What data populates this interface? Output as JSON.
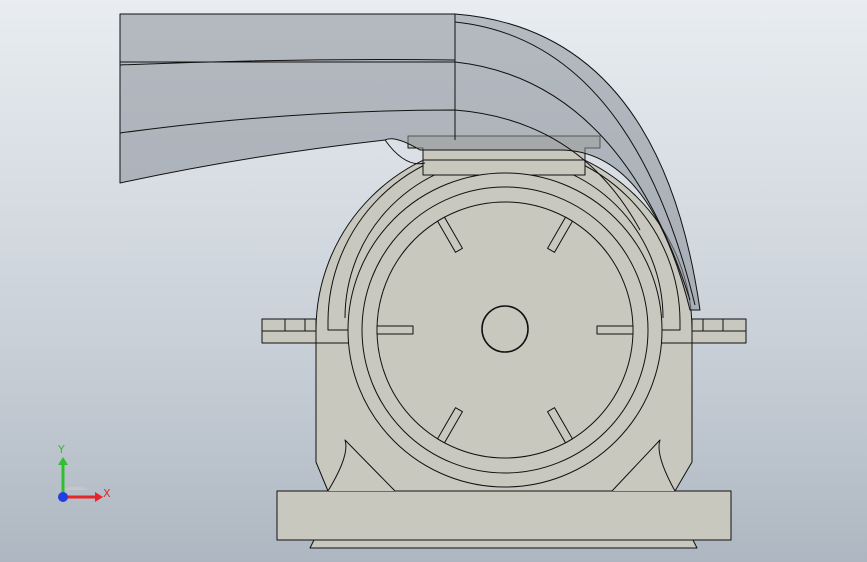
{
  "viewport": {
    "background_top": "#e9edf1",
    "background_bottom": "#aeb7c1"
  },
  "model": {
    "body_color": "#c8c8bf",
    "duct_color": "#8a9099",
    "edge_color": "#111111",
    "slot_count": 6
  },
  "triad": {
    "x_label": "X",
    "y_label": "Y",
    "x_color": "#e8242a",
    "y_color": "#2fbf2f",
    "z_color": "#1f3fe0"
  }
}
